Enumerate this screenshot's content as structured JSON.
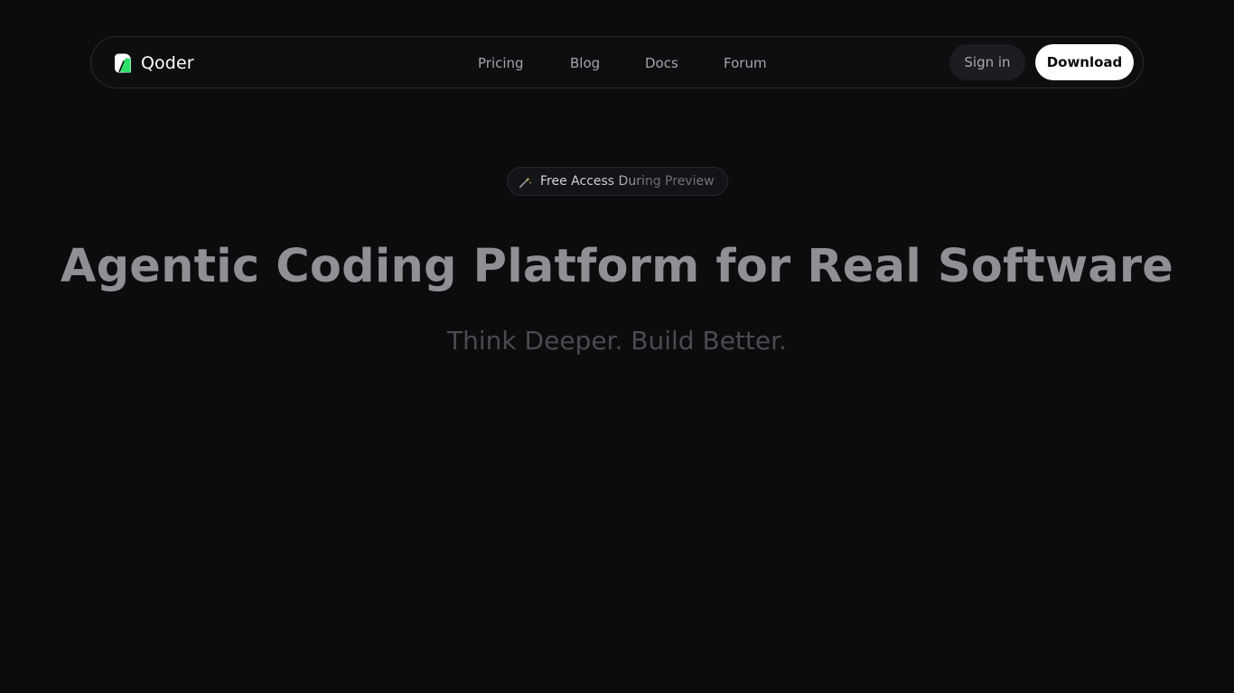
{
  "brand": {
    "name": "Qoder",
    "logo_icon": "qoder-logo-icon",
    "colors": {
      "logo_light": "#ffffff",
      "logo_accent": "#2ee06b"
    }
  },
  "nav": {
    "links": [
      {
        "label": "Pricing"
      },
      {
        "label": "Blog"
      },
      {
        "label": "Docs"
      },
      {
        "label": "Forum"
      }
    ],
    "sign_in_label": "Sign in",
    "download_label": "Download"
  },
  "hero": {
    "badge": {
      "icon": "magic-wand-icon",
      "text": "Free Access During Preview"
    },
    "headline": "Agentic Coding Platform for Real Software",
    "subhead": "Think Deeper. Build Better."
  },
  "colors": {
    "background": "#0b0c0e",
    "download_bg": "#ffffff",
    "signin_bg": "#1c1d20"
  }
}
